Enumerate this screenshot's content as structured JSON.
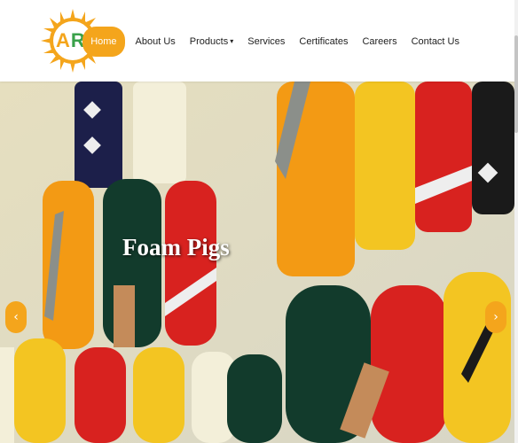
{
  "brand": {
    "logo_text": "ARR",
    "colors": {
      "sun": "#f4a51c",
      "green": "#3aa14a"
    }
  },
  "nav": {
    "items": [
      {
        "label": "Home",
        "active": true
      },
      {
        "label": "About Us"
      },
      {
        "label": "Products",
        "has_dropdown": true
      },
      {
        "label": "Services"
      },
      {
        "label": "Certificates"
      },
      {
        "label": "Careers"
      },
      {
        "label": "Contact Us"
      }
    ],
    "dropdown_icon": "chevron-down-icon"
  },
  "hero": {
    "slide_title": "Foam Pigs",
    "prev_icon": "‹",
    "next_icon": "›"
  },
  "colors": {
    "accent": "#f4a51c"
  }
}
